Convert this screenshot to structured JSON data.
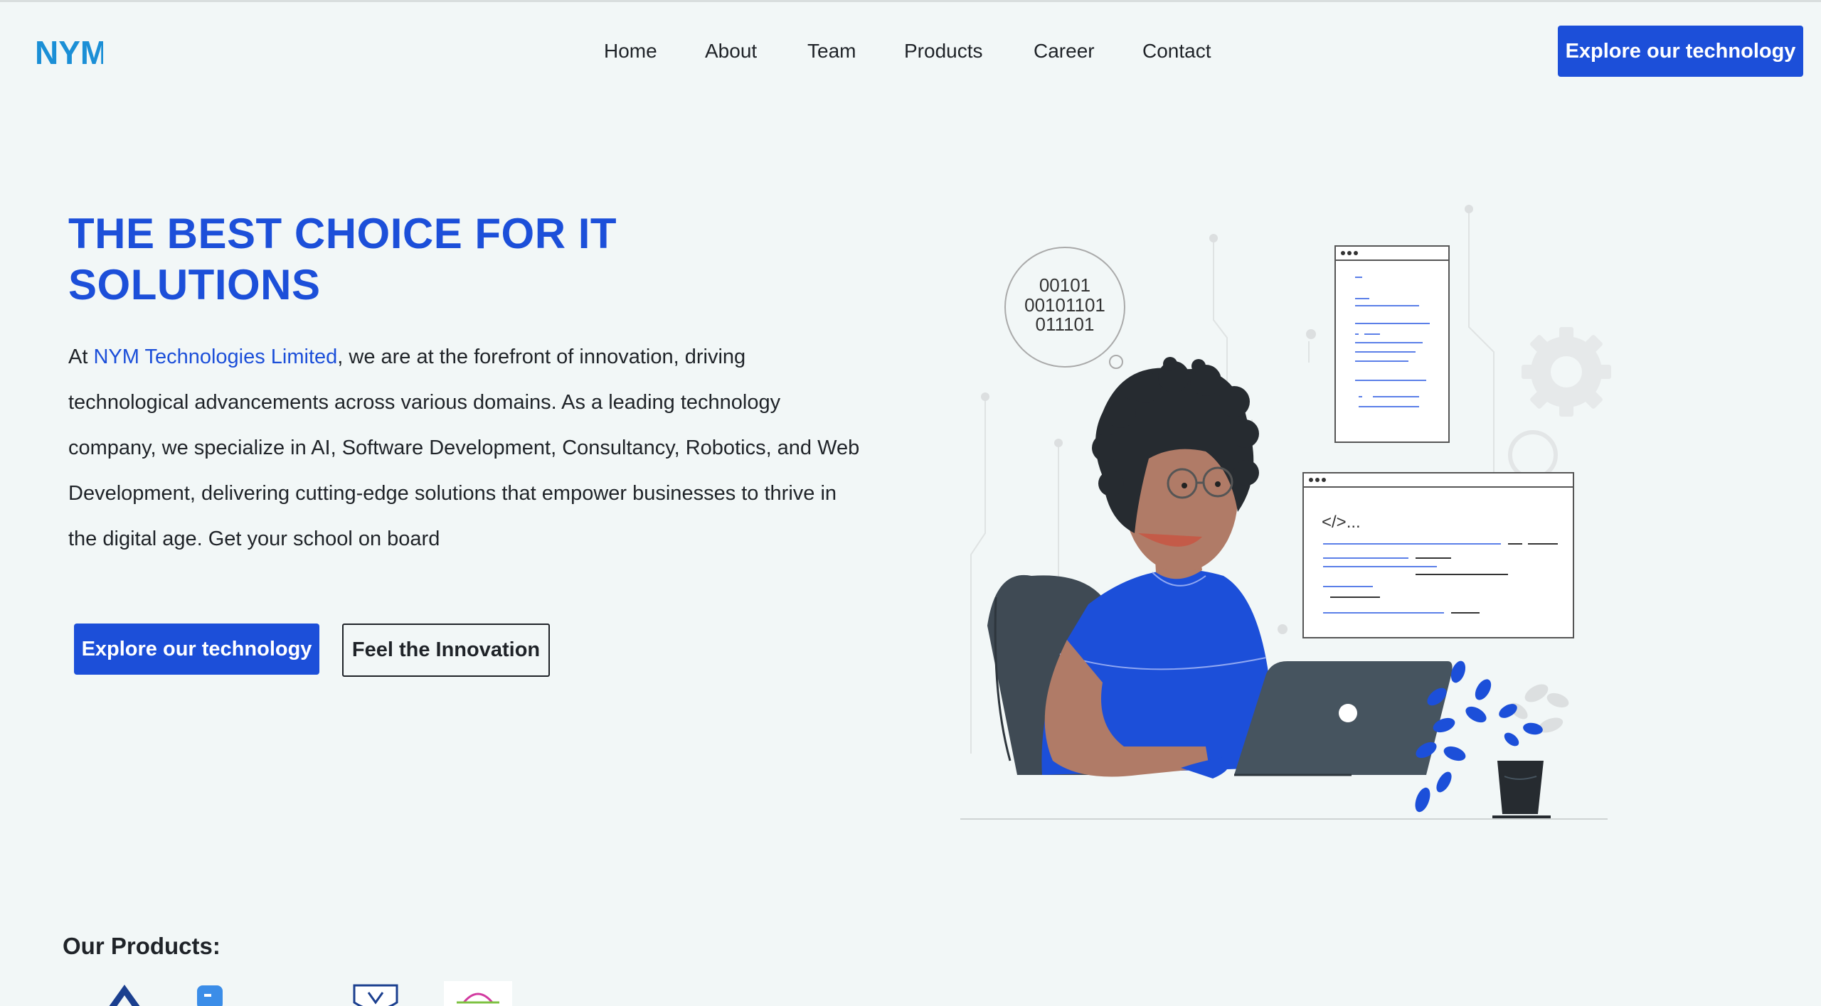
{
  "header": {
    "logo_text": "NYM",
    "nav": [
      "Home",
      "About",
      "Team",
      "Products",
      "Career",
      "Contact"
    ],
    "cta_label": "Explore our technology"
  },
  "hero": {
    "title": "THE BEST CHOICE FOR IT SOLUTIONS",
    "text_before": "At ",
    "brand": "NYM Technologies Limited",
    "text_after": ", we are at the forefront of innovation, driving technological advancements across various domains. As a leading technology company, we specialize in AI, Software Development, Consultancy, Robotics, and Web Development, delivering cutting-edge solutions that empower businesses to thrive in the digital age. Get your school on board",
    "primary_button": "Explore our technology",
    "secondary_button": "Feel the Innovation"
  },
  "illustration": {
    "binary_lines": [
      "00101",
      "00101101",
      "011101"
    ],
    "code_tag": "</>..."
  },
  "products": {
    "title": "Our Products:"
  },
  "colors": {
    "accent": "#1c4fd9",
    "background": "#f2f7f7",
    "text": "#1f2328",
    "logo": "#1b8fd6"
  }
}
